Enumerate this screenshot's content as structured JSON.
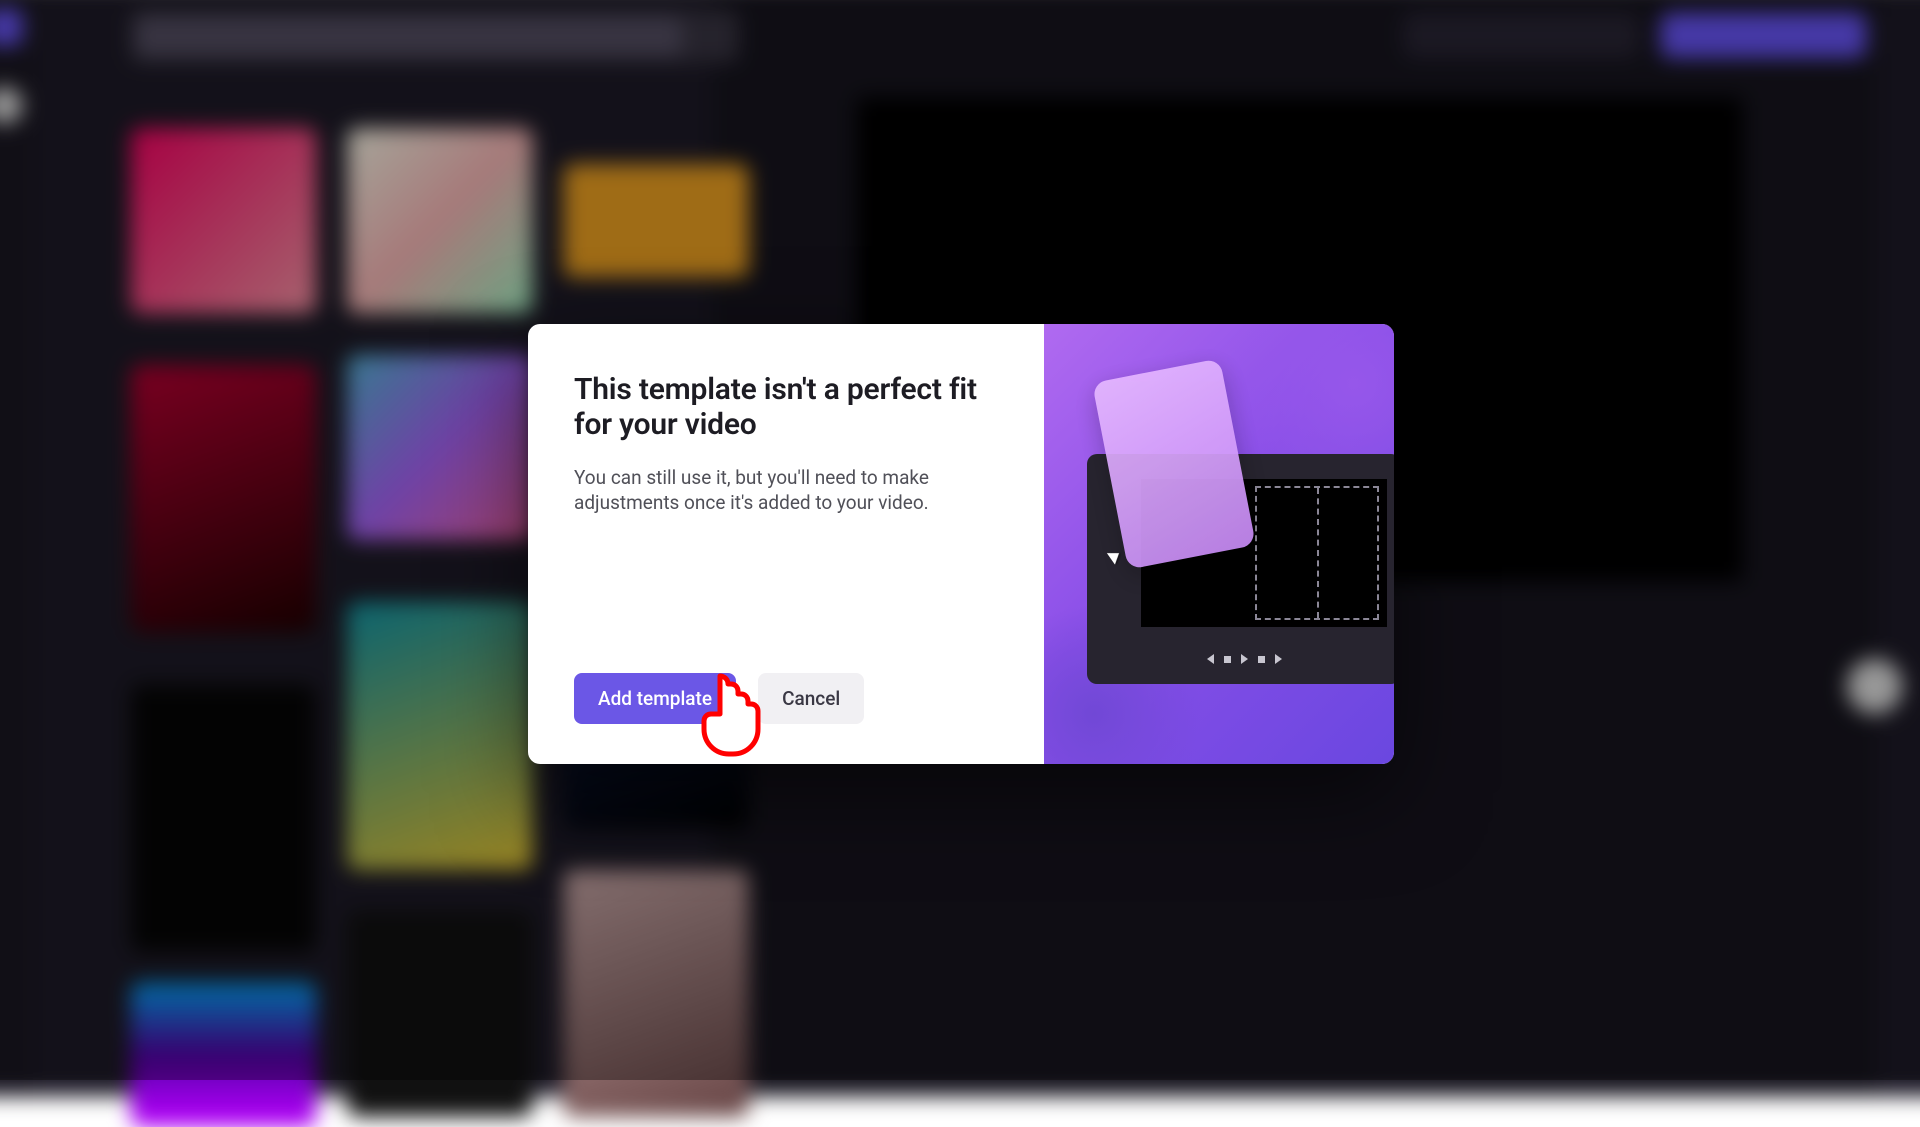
{
  "modal": {
    "title": "This template isn't a perfect fit for your video",
    "description": "You can still use it, but you'll need to make adjustments once it's added to your video.",
    "primary_label": "Add template",
    "secondary_label": "Cancel"
  },
  "colors": {
    "primary": "#6b57e6",
    "bg_dark": "#17151f"
  }
}
